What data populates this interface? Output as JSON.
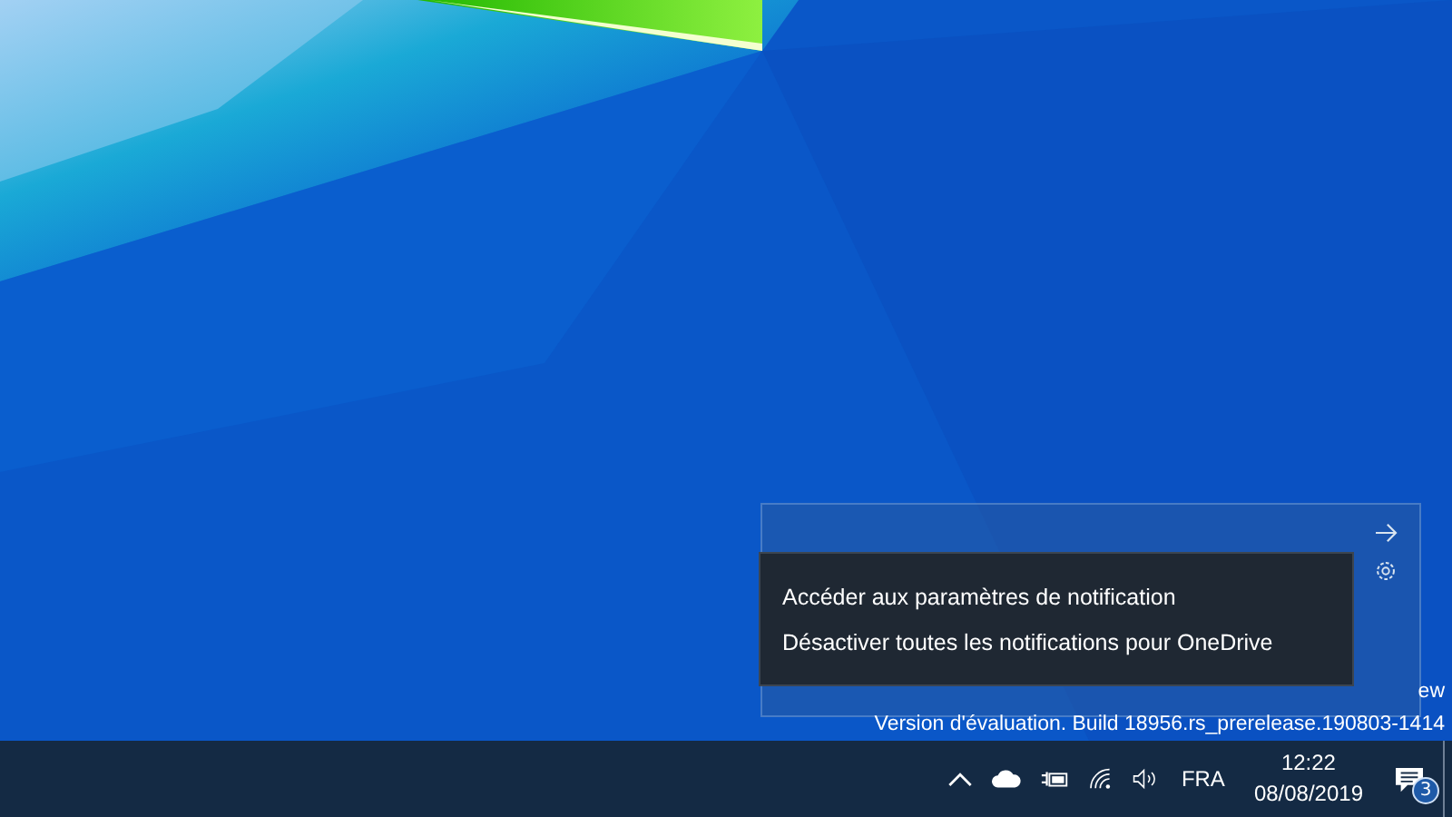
{
  "desktop": {
    "watermark": [
      "ew",
      "Version d'évaluation. Build 18956.rs_prerelease.190803-1414"
    ]
  },
  "context_menu": {
    "items": [
      {
        "label": "Accéder aux paramètres de notification"
      },
      {
        "label": "Désactiver toutes les notifications pour OneDrive"
      }
    ]
  },
  "taskbar": {
    "language": "FRA",
    "time": "12:22",
    "date": "08/08/2019",
    "notification_count": "3"
  }
}
